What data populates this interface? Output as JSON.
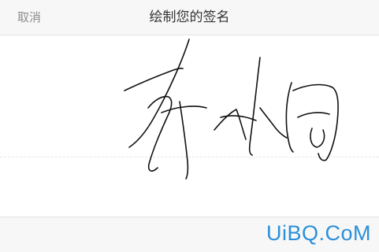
{
  "header": {
    "cancel_label": "取消",
    "title": "绘制您的签名"
  },
  "signature": {
    "stroke_color": "#111111"
  },
  "watermark": {
    "text": "UiBQ.CoM",
    "color": "#2a8fd9"
  }
}
